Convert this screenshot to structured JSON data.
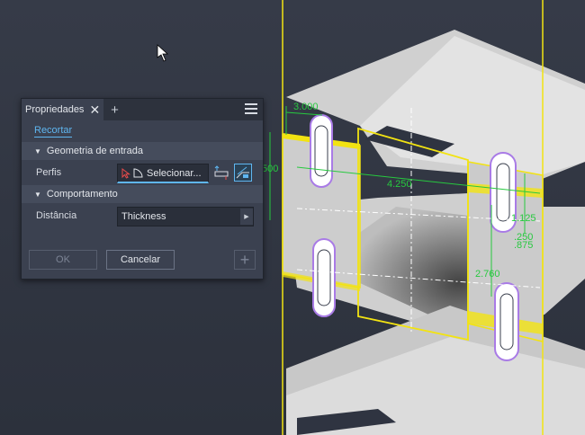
{
  "panel": {
    "tab_label": "Propriedades",
    "subtab_label": "Recortar",
    "section_input": "Geometria de entrada",
    "profiles_label": "Perfis",
    "selector_text": "Selecionar...",
    "section_behavior": "Comportamento",
    "distance_label": "Distância",
    "distance_value": "Thickness",
    "ok_label": "OK",
    "cancel_label": "Cancelar",
    "add_label": "+"
  },
  "dimensions": {
    "d1": "3.000",
    "d2": "500",
    "d3": "4.250",
    "d4": "1.125",
    "d5": ".250",
    ".875": ".875",
    "d6": "2.760"
  },
  "colors": {
    "accent": "#5fb6f0",
    "highlight": "#f2e312",
    "dimension": "#27c93f",
    "slot": "#a97be6"
  }
}
